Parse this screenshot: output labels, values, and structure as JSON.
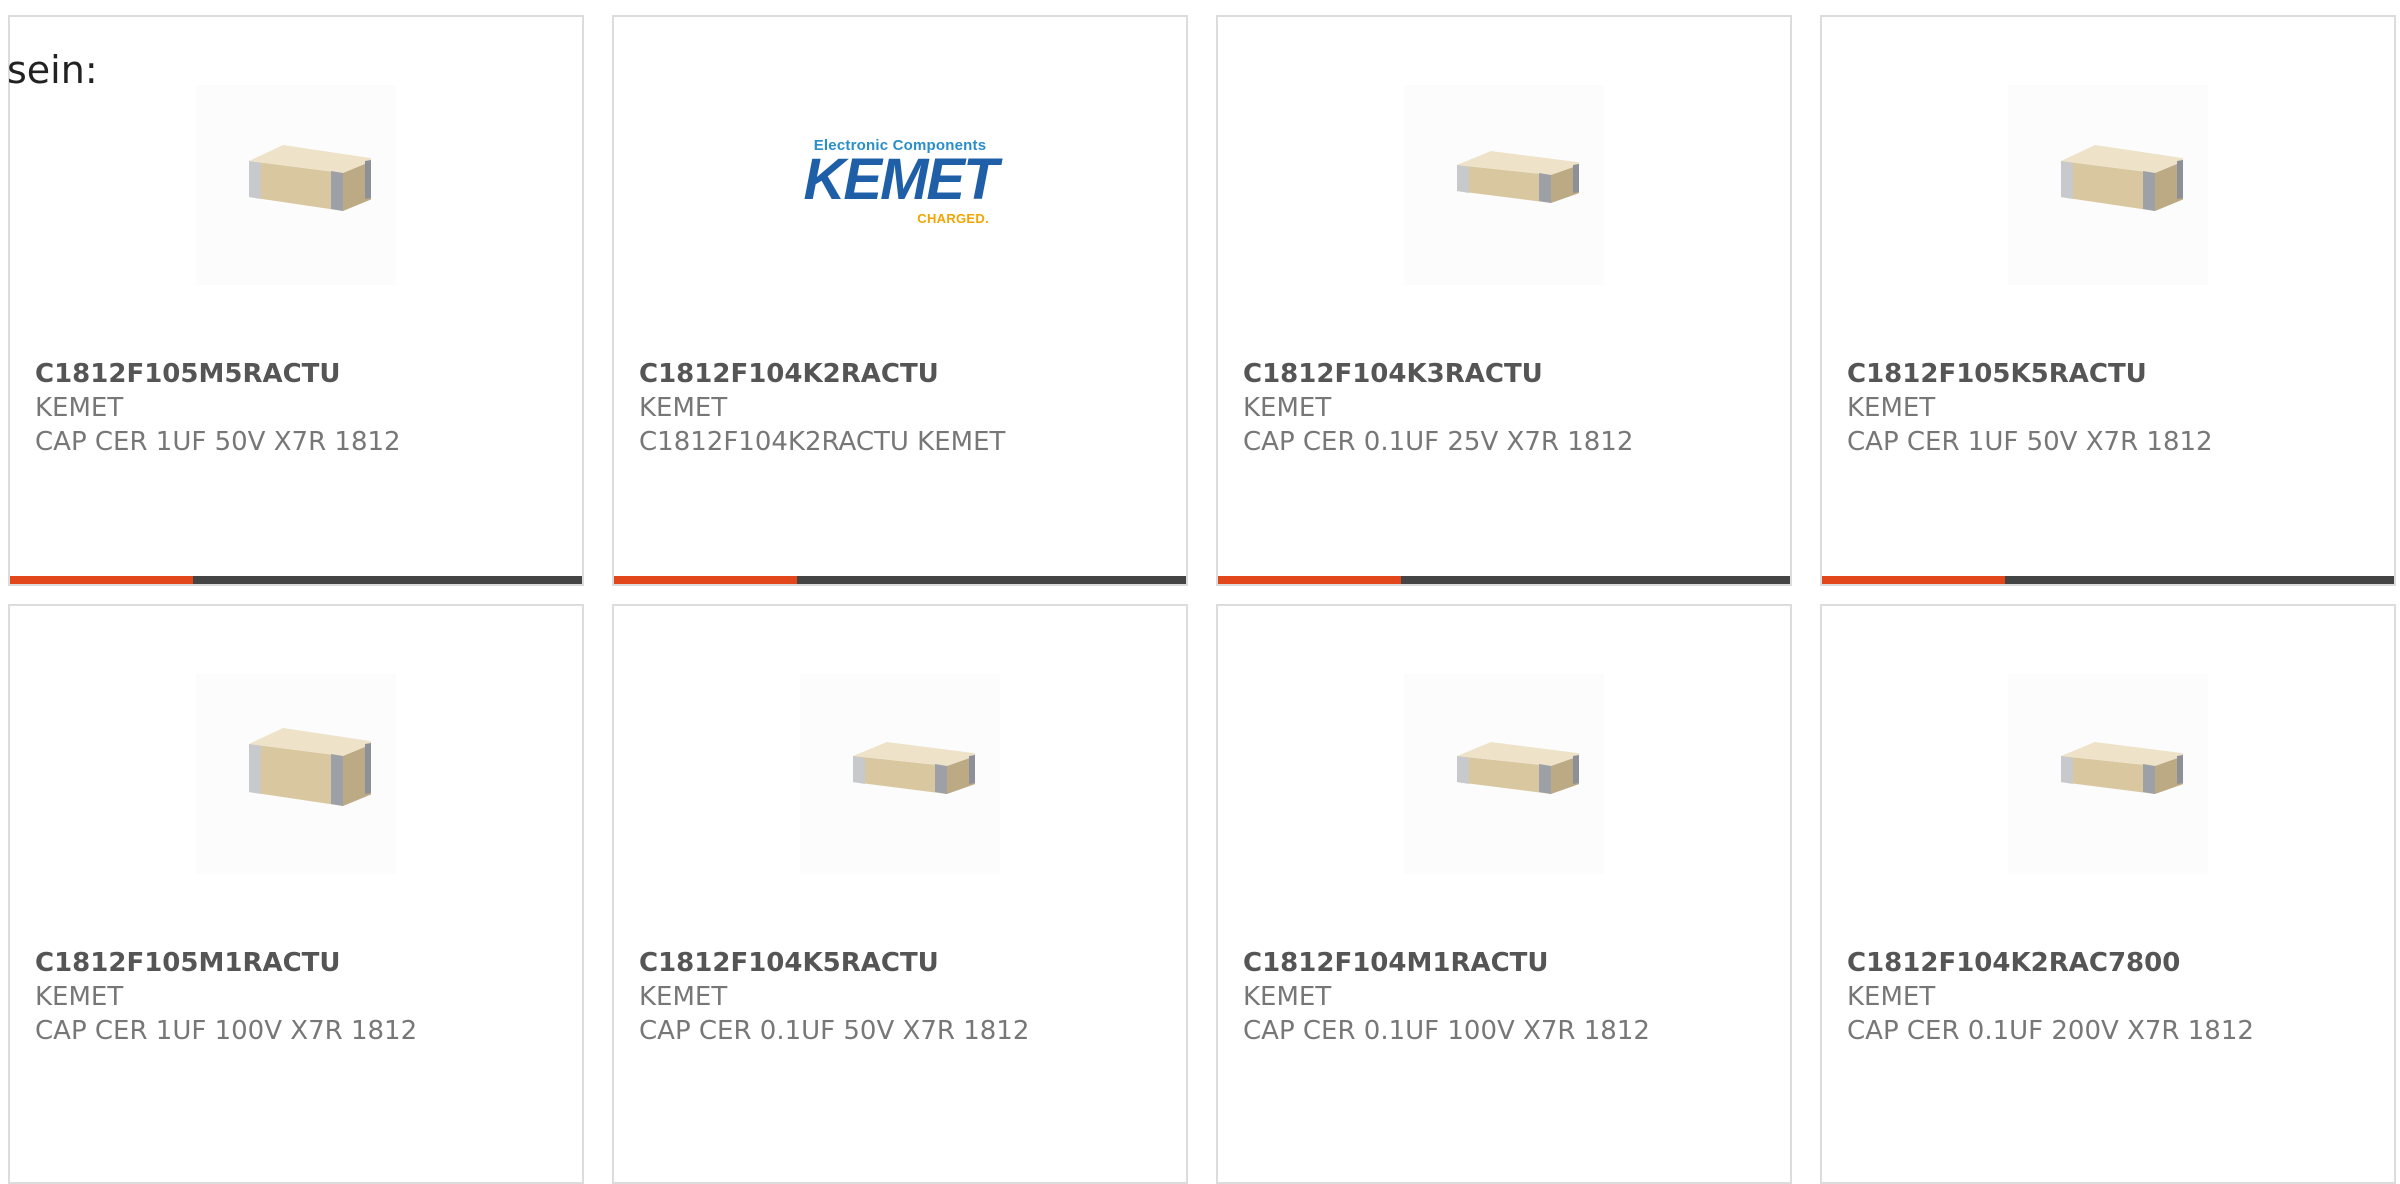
{
  "intro": "sein:",
  "colors": {
    "accent": "#e2461b",
    "bar_track": "#444444",
    "title": "#555555",
    "text": "#777777",
    "logo_blue": "#1f5fa8",
    "logo_light_blue": "#2a8ec8",
    "logo_gold": "#f0a500"
  },
  "cards": [
    {
      "part_number": "C1812F105M5RACTU",
      "manufacturer": "KEMET",
      "description": "CAP CER 1UF 50V X7R 1812",
      "image": "capacitor-chip-icon",
      "progress": 0.32
    },
    {
      "part_number": "C1812F104K2RACTU",
      "manufacturer": "KEMET",
      "description": "C1812F104K2RACTU KEMET",
      "image": "kemet-logo",
      "logo": {
        "top": "Electronic Components",
        "main": "KEMET",
        "sub": "CHARGED."
      },
      "progress": 0.32
    },
    {
      "part_number": "C1812F104K3RACTU",
      "manufacturer": "KEMET",
      "description": "CAP CER 0.1UF 25V X7R 1812",
      "image": "capacitor-chip-icon",
      "progress": 0.32
    },
    {
      "part_number": "C1812F105K5RACTU",
      "manufacturer": "KEMET",
      "description": "CAP CER 1UF 50V X7R 1812",
      "image": "capacitor-chip-icon",
      "progress": 0.32
    },
    {
      "part_number": "C1812F105M1RACTU",
      "manufacturer": "KEMET",
      "description": "CAP CER 1UF 100V X7R 1812",
      "image": "capacitor-chip-icon"
    },
    {
      "part_number": "C1812F104K5RACTU",
      "manufacturer": "KEMET",
      "description": "CAP CER 0.1UF 50V X7R 1812",
      "image": "capacitor-chip-icon"
    },
    {
      "part_number": "C1812F104M1RACTU",
      "manufacturer": "KEMET",
      "description": "CAP CER 0.1UF 100V X7R 1812",
      "image": "capacitor-chip-icon"
    },
    {
      "part_number": "C1812F104K2RAC7800",
      "manufacturer": "KEMET",
      "description": "CAP CER 0.1UF 200V X7R 1812",
      "image": "capacitor-chip-icon"
    }
  ]
}
